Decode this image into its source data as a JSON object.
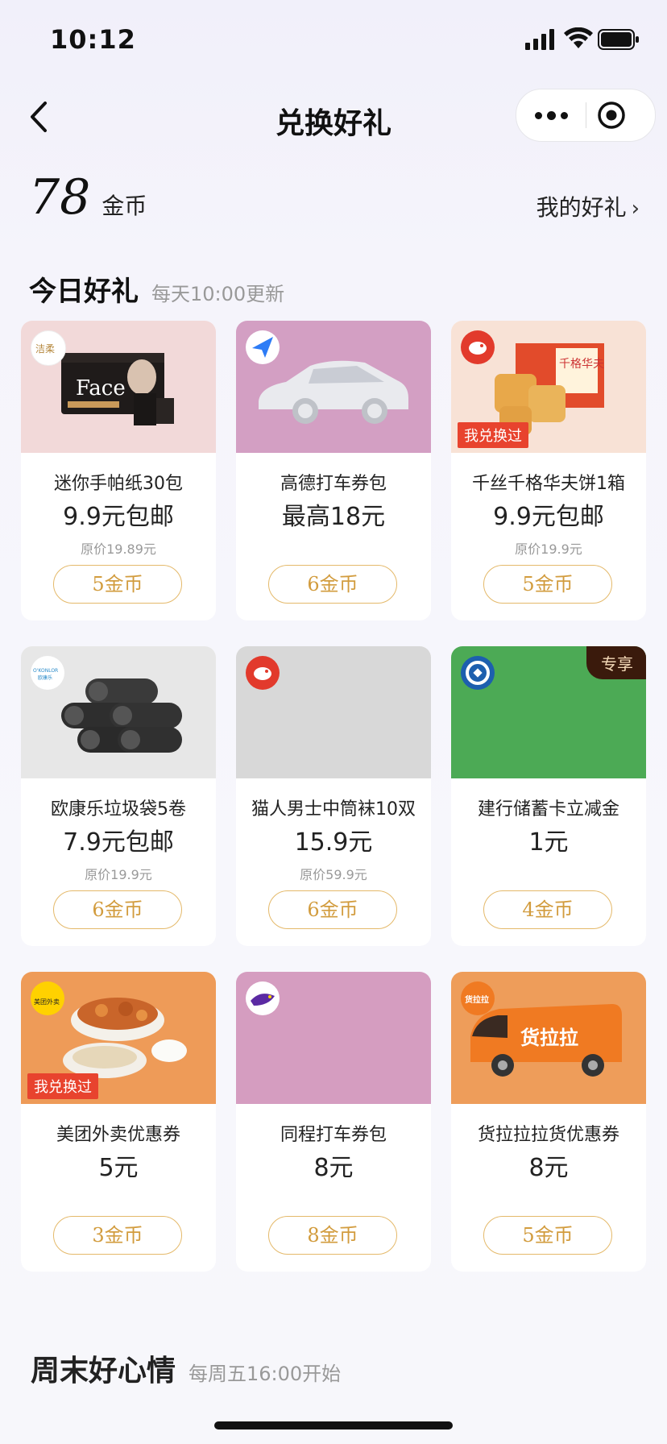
{
  "status_bar": {
    "time": "10:12"
  },
  "nav": {
    "title": "兑换好礼"
  },
  "balance": {
    "amount": "78",
    "unit": "金币",
    "my_gifts_label": "我的好礼",
    "chevron": "›"
  },
  "today": {
    "title": "今日好礼",
    "subtitle": "每天10:00更新"
  },
  "products": [
    {
      "name": "迷你手帕纸30包",
      "price": "9.9元包邮",
      "original": "原价19.89元",
      "cost": "5金币",
      "img_bg": "#f2d9d9",
      "tag": ""
    },
    {
      "name": "高德打车券包",
      "price": "最高18元",
      "original": "",
      "cost": "6金币",
      "img_bg": "#d39fc3",
      "tag": ""
    },
    {
      "name": "千丝千格华夫饼1箱",
      "price": "9.9元包邮",
      "original": "原价19.9元",
      "cost": "5金币",
      "img_bg": "#f8e2d6",
      "tag": "我兑换过"
    },
    {
      "name": "欧康乐垃圾袋5卷",
      "price": "7.9元包邮",
      "original": "原价19.9元",
      "cost": "6金币",
      "img_bg": "#e7e7e7",
      "tag": ""
    },
    {
      "name": "猫人男士中筒袜10双",
      "price": "15.9元",
      "original": "原价59.9元",
      "cost": "6金币",
      "img_bg": "#d8d8d8",
      "tag": ""
    },
    {
      "name": "建行储蓄卡立减金",
      "price": "1元",
      "original": "",
      "cost": "4金币",
      "img_bg": "#4caa55",
      "tag": "专享"
    },
    {
      "name": "美团外卖优惠券",
      "price": "5元",
      "original": "",
      "cost": "3金币",
      "img_bg": "#ee9b58",
      "tag": "我兑换过"
    },
    {
      "name": "同程打车券包",
      "price": "8元",
      "original": "",
      "cost": "8金币",
      "img_bg": "#d59dc0",
      "tag": ""
    },
    {
      "name": "货拉拉拉货优惠券",
      "price": "8元",
      "original": "",
      "cost": "5金币",
      "img_bg": "#ee9d5a",
      "tag": ""
    }
  ],
  "brand_text": {
    "tissue_face": "Face",
    "tissue_brand": "洁柔",
    "okonlo": "O'KONLOR",
    "okonlo_cn": "欧康乐",
    "waffle_box": "千格华夫",
    "meituan": "美团外卖",
    "huolala": "货拉拉"
  },
  "weekend": {
    "title": "周末好心情",
    "subtitle": "每周五16:00开始"
  }
}
